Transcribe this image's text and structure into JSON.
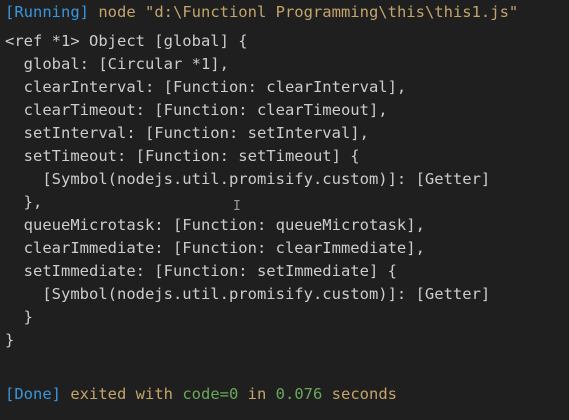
{
  "colors": {
    "background": "#1f1f1f",
    "text": "#cccccc",
    "status_tag": "#3a96dd",
    "command": "#c4a46a",
    "number": "#6aa85a"
  },
  "header": {
    "status": "[Running]",
    "command": " node \"d:\\Functionl Programming\\this\\this1.js\""
  },
  "output": {
    "lines": [
      "<ref *1> Object [global] {",
      "  global: [Circular *1],",
      "  clearInterval: [Function: clearInterval],",
      "  clearTimeout: [Function: clearTimeout],",
      "  setInterval: [Function: setInterval],",
      "  setTimeout: [Function: setTimeout] {",
      "    [Symbol(nodejs.util.promisify.custom)]: [Getter]",
      "  },",
      "  queueMicrotask: [Function: queueMicrotask],",
      "  clearImmediate: [Function: clearImmediate],",
      "  setImmediate: [Function: setImmediate] {",
      "    [Symbol(nodejs.util.promisify.custom)]: [Getter]",
      "  }",
      "}"
    ]
  },
  "footer": {
    "status": "[Done]",
    "exited_text": " exited with ",
    "code_label": "code=0",
    "in_text": " in ",
    "time_value": "0.076",
    "seconds_text": " seconds"
  },
  "cursor_glyph": "I"
}
